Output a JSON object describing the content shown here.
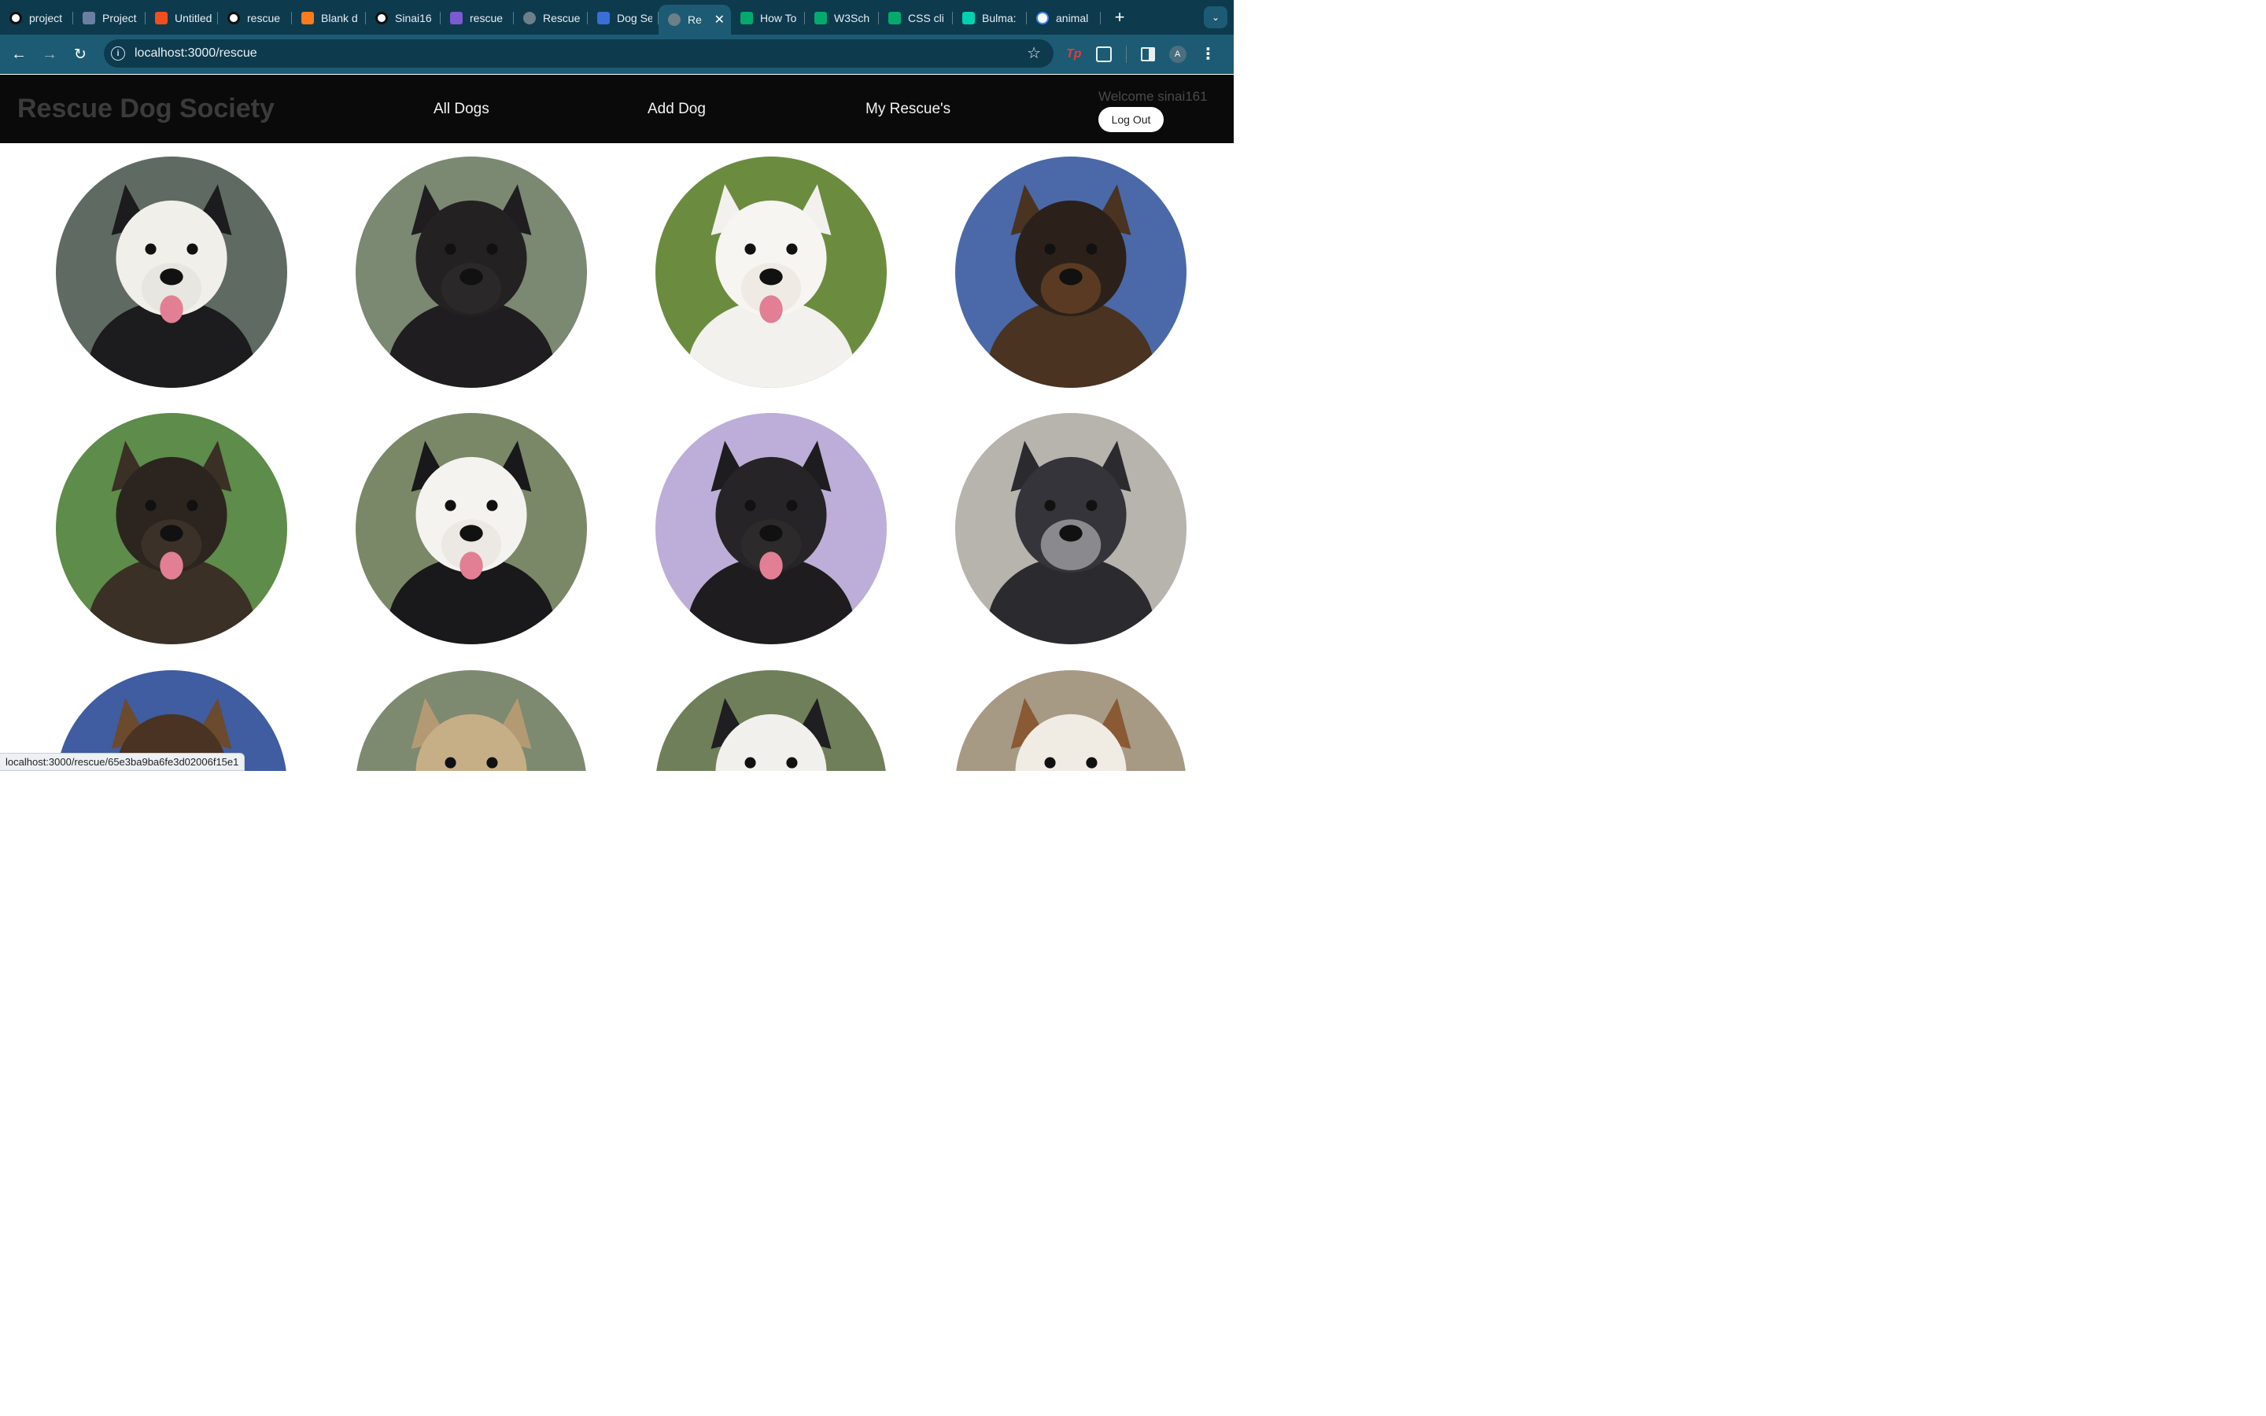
{
  "browser": {
    "tabs": [
      {
        "title": "project",
        "icon": "github-icon",
        "color": "#111111"
      },
      {
        "title": "Project",
        "icon": "trello-icon",
        "color": "#6b7fa3"
      },
      {
        "title": "Untitled",
        "icon": "figma-icon",
        "color": "#f24e1e"
      },
      {
        "title": "rescue",
        "icon": "github-icon",
        "color": "#111111"
      },
      {
        "title": "Blank d",
        "icon": "blank-icon",
        "color": "#ff7a1a"
      },
      {
        "title": "Sinai16",
        "icon": "github-icon",
        "color": "#111111"
      },
      {
        "title": "rescue",
        "icon": "heroku-icon",
        "color": "#7b5bd1"
      },
      {
        "title": "Rescue",
        "icon": "globe-icon",
        "color": "#6d7f88"
      },
      {
        "title": "Dog Se",
        "icon": "paw-icon",
        "color": "#3a6fd8"
      },
      {
        "title": "Re",
        "icon": "globe-icon",
        "color": "#6d7f88",
        "active": true
      },
      {
        "title": "How To",
        "icon": "w3schools-icon",
        "color": "#04aa6d"
      },
      {
        "title": "W3Sch",
        "icon": "w3schools-icon",
        "color": "#04aa6d"
      },
      {
        "title": "CSS cli",
        "icon": "w3schools-icon",
        "color": "#04aa6d"
      },
      {
        "title": "Bulma:",
        "icon": "bulma-icon",
        "color": "#00d1b2"
      },
      {
        "title": "animal",
        "icon": "google-icon",
        "color": "#ffffff"
      }
    ],
    "new_tab_label": "+",
    "url": "localhost:3000/rescue",
    "status_url": "localhost:3000/rescue/65e3ba9ba6fe3d02006f15e1",
    "profile_initial": "A",
    "extension_label": "Tp"
  },
  "app": {
    "brand": "Rescue Dog Society",
    "nav": {
      "all_dogs": "All Dogs",
      "add_dog": "Add Dog",
      "my_rescues": "My Rescue's"
    },
    "welcome": "Welcome sinai161",
    "logout_label": "Log Out"
  },
  "dogs": [
    {
      "name": "dog-photo-1",
      "bg": "#5f6b62",
      "fur": "#1c1b1d",
      "face": "#f1efe9",
      "muzzle": "#e8e6e0",
      "tongue": true
    },
    {
      "name": "dog-photo-2",
      "bg": "#7b8872",
      "fur": "#1f1d1f",
      "face": "#232122",
      "muzzle": "#2a2828",
      "tongue": false
    },
    {
      "name": "dog-photo-3",
      "bg": "#6b8c3e",
      "fur": "#f2f1ee",
      "face": "#f6f5f2",
      "muzzle": "#efeae4",
      "tongue": true
    },
    {
      "name": "dog-photo-4",
      "bg": "#4b69a8",
      "fur": "#4a3320",
      "face": "#2b211a",
      "muzzle": "#5a3a22",
      "tongue": false
    },
    {
      "name": "dog-photo-5",
      "bg": "#5e8c4a",
      "fur": "#3a3026",
      "face": "#2c251f",
      "muzzle": "#3b3129",
      "tongue": true
    },
    {
      "name": "dog-photo-6",
      "bg": "#7a8868",
      "fur": "#19181a",
      "face": "#f4f3ef",
      "muzzle": "#ece9e4",
      "tongue": true
    },
    {
      "name": "dog-photo-7",
      "bg": "#bcaed8",
      "fur": "#1e1c1e",
      "face": "#262426",
      "muzzle": "#2c2a2b",
      "tongue": true
    },
    {
      "name": "dog-photo-8",
      "bg": "#b7b3ad",
      "fur": "#2b2b2f",
      "face": "#34343a",
      "muzzle": "#8a8a8e",
      "tongue": false
    },
    {
      "name": "dog-photo-9",
      "bg": "#3f5da0",
      "fur": "#6b4a2e",
      "face": "#4a3322",
      "muzzle": "#6a4a30",
      "tongue": false
    },
    {
      "name": "dog-photo-10",
      "bg": "#7e8a70",
      "fur": "#b49a73",
      "face": "#c6ae86",
      "muzzle": "#2b2520",
      "tongue": false
    },
    {
      "name": "dog-photo-11",
      "bg": "#6f7f5a",
      "fur": "#1f1e20",
      "face": "#f2f0ec",
      "muzzle": "#e9e6e0",
      "tongue": true
    },
    {
      "name": "dog-photo-12",
      "bg": "#a79a84",
      "fur": "#8a5a34",
      "face": "#f0ebe3",
      "muzzle": "#e9e2d6",
      "tongue": false
    }
  ]
}
